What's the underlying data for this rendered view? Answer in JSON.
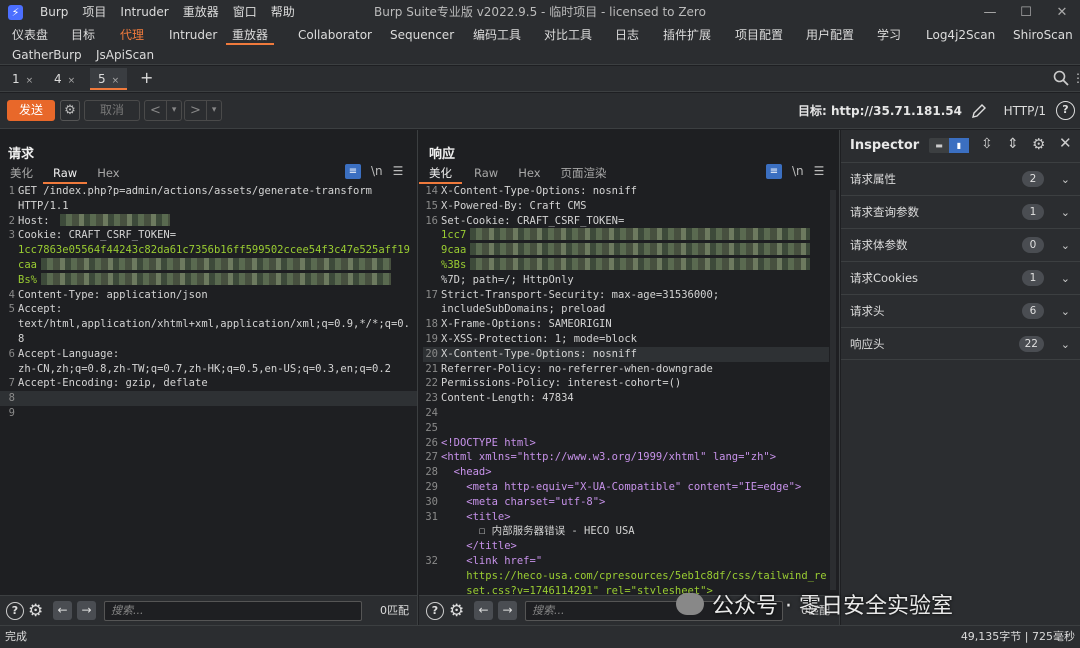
{
  "titlebar": {
    "logo": "⚡",
    "menus": [
      "Burp",
      "项目",
      "Intruder",
      "重放器",
      "窗口",
      "帮助"
    ],
    "title": "Burp Suite专业版  v2022.9.5 - 临时项目 - licensed to Zero",
    "controls": [
      "—",
      "☐",
      "✕"
    ]
  },
  "main_tabs": [
    "仪表盘",
    "目标",
    "代理",
    "Intruder",
    "重放器",
    "Collaborator",
    "Sequencer",
    "编码工具",
    "对比工具",
    "日志",
    "插件扩展",
    "项目配置",
    "用户配置",
    "学习",
    "Log4j2Scan",
    "ShiroScan",
    "GatherBurp",
    "JsApiScan"
  ],
  "sub_tabs": [
    {
      "label": "1"
    },
    {
      "label": "4"
    },
    {
      "label": "5"
    }
  ],
  "sub_tab_close": "×",
  "toolbar": {
    "send": "发送",
    "cancel": "取消",
    "target": "目标: http://35.71.181.54",
    "http_version": "HTTP/1"
  },
  "request": {
    "title": "请求",
    "tabs": [
      "美化",
      "Raw",
      "Hex"
    ],
    "newline_toggle": "\\n",
    "lines": [
      {
        "n": "1",
        "text": "GET /index.php?p=admin/actions/assets/generate-transform"
      },
      {
        "n": "",
        "text": "HTTP/1.1"
      },
      {
        "n": "2",
        "text": "Host: "
      },
      {
        "n": "3",
        "text": "Cookie: CRAFT_CSRF_TOKEN="
      },
      {
        "n": "",
        "text": "1cc7863e05564f44243c82da61c7356b16ff599502ccee54f3c47e525aff19"
      },
      {
        "n": "",
        "text": "caa"
      },
      {
        "n": "",
        "text": "Bs%"
      },
      {
        "n": "4",
        "text": "Content-Type: application/json"
      },
      {
        "n": "5",
        "text": "Accept:"
      },
      {
        "n": "",
        "text": "text/html,application/xhtml+xml,application/xml;q=0.9,*/*;q=0."
      },
      {
        "n": "",
        "text": "8"
      },
      {
        "n": "6",
        "text": "Accept-Language:"
      },
      {
        "n": "",
        "text": "zh-CN,zh;q=0.8,zh-TW;q=0.7,zh-HK;q=0.5,en-US;q=0.3,en;q=0.2"
      },
      {
        "n": "7",
        "text": "Accept-Encoding: gzip, deflate"
      },
      {
        "n": "8",
        "text": ""
      },
      {
        "n": "9",
        "text": ""
      }
    ],
    "search_placeholder": "搜索...",
    "match_count": "0匹配"
  },
  "response": {
    "title": "响应",
    "tabs": [
      "美化",
      "Raw",
      "Hex",
      "页面渲染"
    ],
    "newline_toggle": "\\n",
    "lines": [
      {
        "n": "14",
        "text": "X-Content-Type-Options: nosniff"
      },
      {
        "n": "15",
        "text": "X-Powered-By: Craft CMS"
      },
      {
        "n": "16",
        "text": "Set-Cookie: CRAFT_CSRF_TOKEN="
      },
      {
        "n": "",
        "text": "1cc7"
      },
      {
        "n": "",
        "text": "9caa"
      },
      {
        "n": "",
        "text": "%3Bs"
      },
      {
        "n": "",
        "text": "%7D; path=/; HttpOnly"
      },
      {
        "n": "17",
        "text": "Strict-Transport-Security: max-age=31536000;"
      },
      {
        "n": "",
        "text": "includeSubDomains; preload"
      },
      {
        "n": "18",
        "text": "X-Frame-Options: SAMEORIGIN"
      },
      {
        "n": "19",
        "text": "X-XSS-Protection: 1; mode=block"
      },
      {
        "n": "20",
        "text": "X-Content-Type-Options: nosniff"
      },
      {
        "n": "21",
        "text": "Referrer-Policy: no-referrer-when-downgrade"
      },
      {
        "n": "22",
        "text": "Permissions-Policy: interest-cohort=()"
      },
      {
        "n": "23",
        "text": "Content-Length: 47834"
      },
      {
        "n": "24",
        "text": ""
      },
      {
        "n": "25",
        "text": ""
      },
      {
        "n": "26",
        "text": "<!DOCTYPE html>"
      },
      {
        "n": "27",
        "text": "<html xmlns=\"http://www.w3.org/1999/xhtml\" lang=\"zh\">"
      },
      {
        "n": "28",
        "text": "  <head>"
      },
      {
        "n": "29",
        "text": "    <meta http-equiv=\"X-UA-Compatible\" content=\"IE=edge\">"
      },
      {
        "n": "30",
        "text": "    <meta charset=\"utf-8\">"
      },
      {
        "n": "31",
        "text": "    <title>"
      },
      {
        "n": "",
        "text": "      ☐ 内部服务器错误 - HECO USA"
      },
      {
        "n": "",
        "text": "    </title>"
      },
      {
        "n": "32",
        "text": "    <link href=\""
      },
      {
        "n": "",
        "text": "    https://heco-usa.com/cpresources/5eb1c8df/css/tailwind_re"
      },
      {
        "n": "",
        "text": "    set.css?v=1746114291\" rel=\"stylesheet\">"
      }
    ],
    "search_placeholder": "搜索...",
    "match_count": "0匹配"
  },
  "inspector": {
    "title": "Inspector",
    "rows": [
      {
        "label": "请求属性",
        "count": "2"
      },
      {
        "label": "请求查询参数",
        "count": "1"
      },
      {
        "label": "请求体参数",
        "count": "0"
      },
      {
        "label": "请求Cookies",
        "count": "1"
      },
      {
        "label": "请求头",
        "count": "6"
      },
      {
        "label": "响应头",
        "count": "22"
      }
    ]
  },
  "status": {
    "left": "完成",
    "right": "49,135字节 | 725毫秒"
  },
  "watermark": "公众号 · 零日安全实验室",
  "colors": {
    "accent": "#e8682a",
    "bg": "#1e1f22",
    "panel": "#2b2d30",
    "toggle": "#3b6fc1"
  }
}
